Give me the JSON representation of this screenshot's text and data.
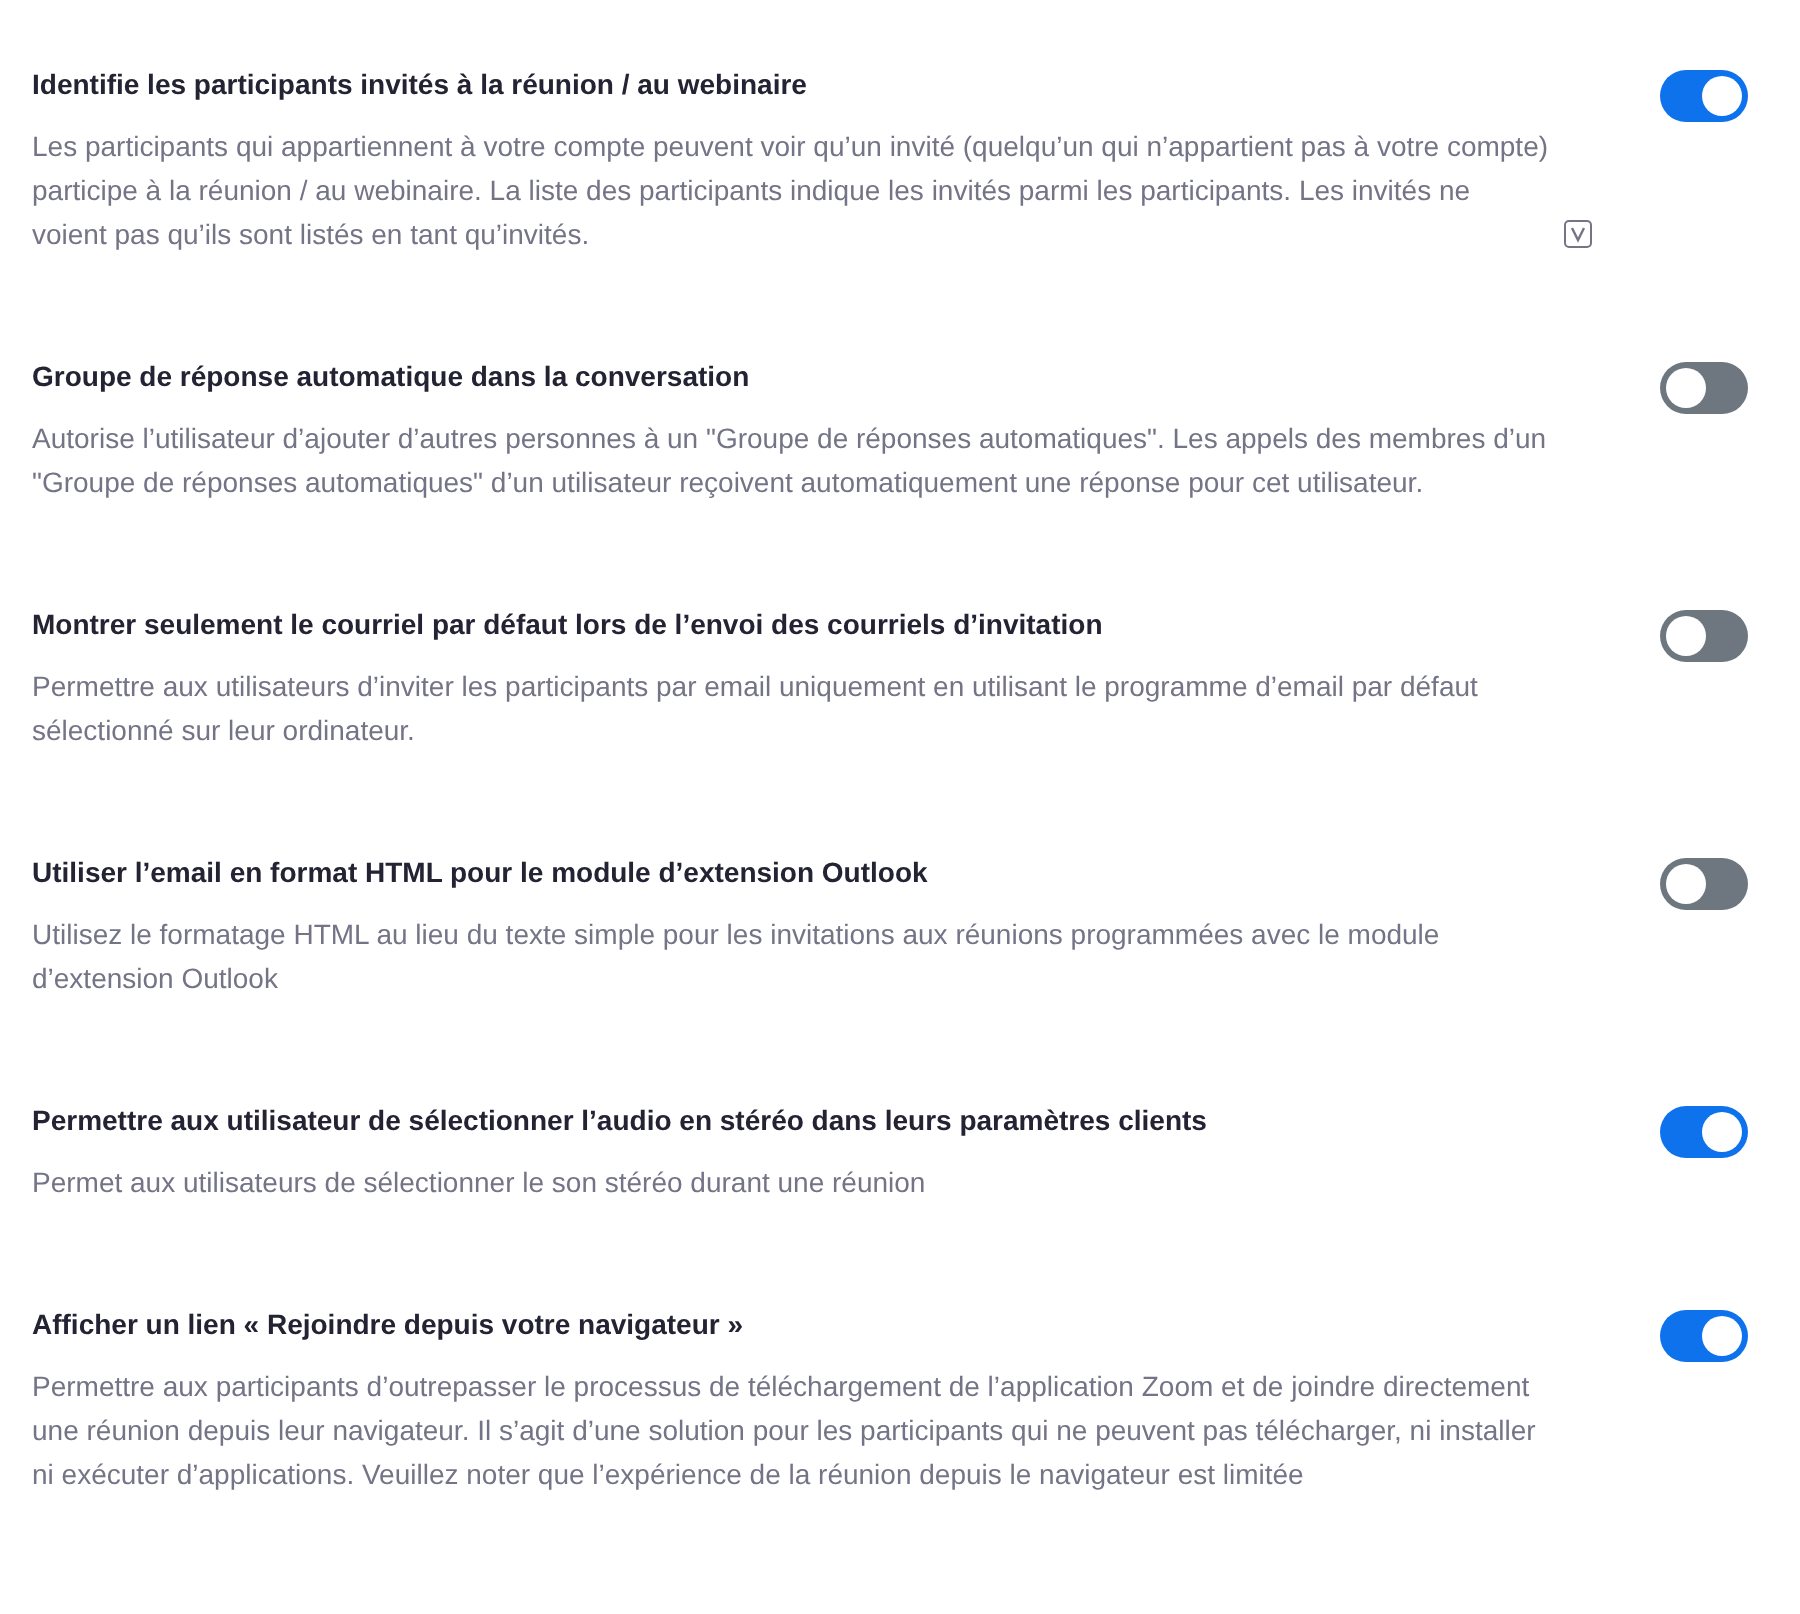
{
  "settings": [
    {
      "title": "Identifie les participants invités à la réunion / au webinaire",
      "description": "Les participants qui appartiennent à votre compte peuvent voir qu’un invité (quelqu’un qui n’appartient pas à votre compte) participe à la réunion / au webinaire. La liste des participants indique les invités parmi les participants. Les invités ne voient pas qu’ils sont listés en tant qu’invités.",
      "has_badge": true,
      "on": true
    },
    {
      "title": "Groupe de réponse automatique dans la conversation",
      "description": "Autorise l’utilisateur d’ajouter d’autres personnes à un \"Groupe de réponses automatiques\". Les appels des membres d’un \"Groupe de réponses automatiques\" d’un utilisateur reçoivent automatiquement une réponse pour cet utilisateur.",
      "has_badge": false,
      "on": false
    },
    {
      "title": "Montrer seulement le courriel par défaut lors de l’envoi des courriels d’invitation",
      "description": "Permettre aux utilisateurs d’inviter les participants par email uniquement en utilisant le programme d’email par défaut sélectionné sur leur ordinateur.",
      "has_badge": false,
      "on": false
    },
    {
      "title": "Utiliser l’email en format HTML pour le module d’extension Outlook",
      "description": "Utilisez le formatage HTML au lieu du texte simple pour les invitations aux réunions programmées avec le module d’extension Outlook",
      "has_badge": false,
      "on": false
    },
    {
      "title": "Permettre aux utilisateur de sélectionner l’audio en stéréo dans leurs paramètres clients",
      "description": "Permet aux utilisateurs de sélectionner le son stéréo durant une réunion",
      "has_badge": false,
      "on": true
    },
    {
      "title": "Afficher un lien « Rejoindre depuis votre navigateur »",
      "description": "Permettre aux participants d’outrepasser le processus de téléchargement de l’application Zoom et de joindre directement une réunion depuis leur navigateur. Il s’agit d’une solution pour les participants qui ne peuvent pas télécharger, ni installer ni exécuter d’applications. Veuillez noter que l’expérience de la réunion depuis le navigateur est limitée",
      "has_badge": false,
      "on": true
    }
  ]
}
